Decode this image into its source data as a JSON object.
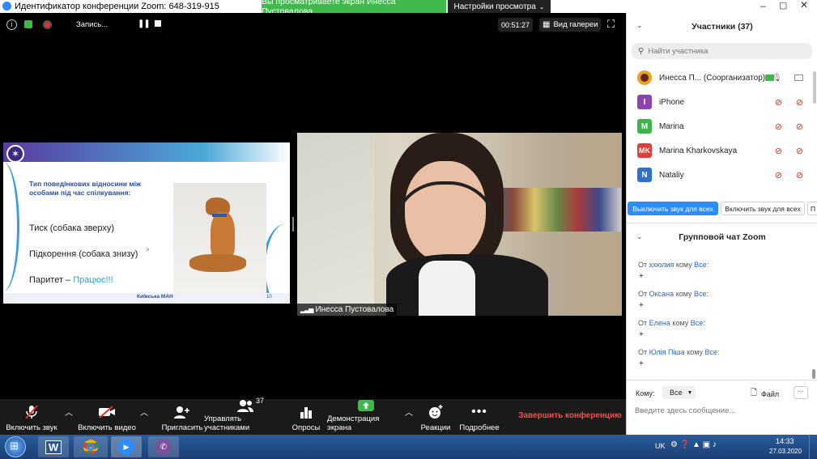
{
  "titlebar": {
    "meeting_id": "Идентификатор конференции Zoom: 648-319-915",
    "share_banner": "Вы просматриваете экран Инесса Пустовалова",
    "view_options": "Настройки просмотра",
    "share_color": "#3fb94b"
  },
  "topbar": {
    "recording": "Запись...",
    "timer": "00:51:27",
    "gallery_view": "Вид галереи"
  },
  "slide": {
    "heading_line1": "Тип поведінкових відносини між",
    "heading_line2": "особами під  час спілкування:",
    "item1": "Тиск (собака зверху)",
    "item2": "Підкорення (собака знизу)",
    "item3_prefix": "Паритет – ",
    "item3_highlight": "Працює!!!",
    "arrow": ">",
    "footer": "Київська МАН",
    "page": "10"
  },
  "video": {
    "participant_name": "Инесса Пустовалова"
  },
  "toolbar": {
    "unmute": "Включить звук",
    "start_video": "Включить видео",
    "invite": "Пригласить",
    "manage_participants": "Управлять участниками",
    "participants_count": "37",
    "polls": "Опросы",
    "share_screen": "Демонстрация экрана",
    "reactions": "Реакции",
    "more": "Подробнее",
    "end": "Завершить конференцию",
    "end_color": "#ff4b4b",
    "share_icon_color": "#3fb94b"
  },
  "participants": {
    "header": "Участники (37)",
    "search_placeholder": "Найти участника",
    "list": [
      {
        "name": "Инесса П...  (Соорганизатор)",
        "initials": "",
        "color": "#f0a020"
      },
      {
        "name": "iPhone",
        "initials": "I",
        "color": "#8e44ad"
      },
      {
        "name": "Marina",
        "initials": "M",
        "color": "#3bb54a"
      },
      {
        "name": "Marina Kharkovskaya",
        "initials": "MK",
        "color": "#d9423a"
      },
      {
        "name": "Nataliy",
        "initials": "N",
        "color": "#2f6fd0"
      }
    ],
    "mute_all": "Выключить звук для всех",
    "unmute_all": "Включить звук для всех",
    "more_short": "П"
  },
  "chat": {
    "header": "Групповой чат Zoom",
    "from": "От",
    "to_word": "кому",
    "to_all": "Все:",
    "messages": [
      {
        "sender": "xxюлия",
        "text": "+"
      },
      {
        "sender": "Оксана",
        "text": "+"
      },
      {
        "sender": "Елена",
        "text": "+"
      },
      {
        "sender": "Юлія Піша",
        "text": "+"
      }
    ],
    "to_label": "Кому:",
    "recipient": "Все",
    "file": "Файл",
    "placeholder": "Введите здесь сообщение..."
  },
  "taskbar": {
    "lang": "UK",
    "time": "14:33",
    "date": "27.03.2020"
  }
}
